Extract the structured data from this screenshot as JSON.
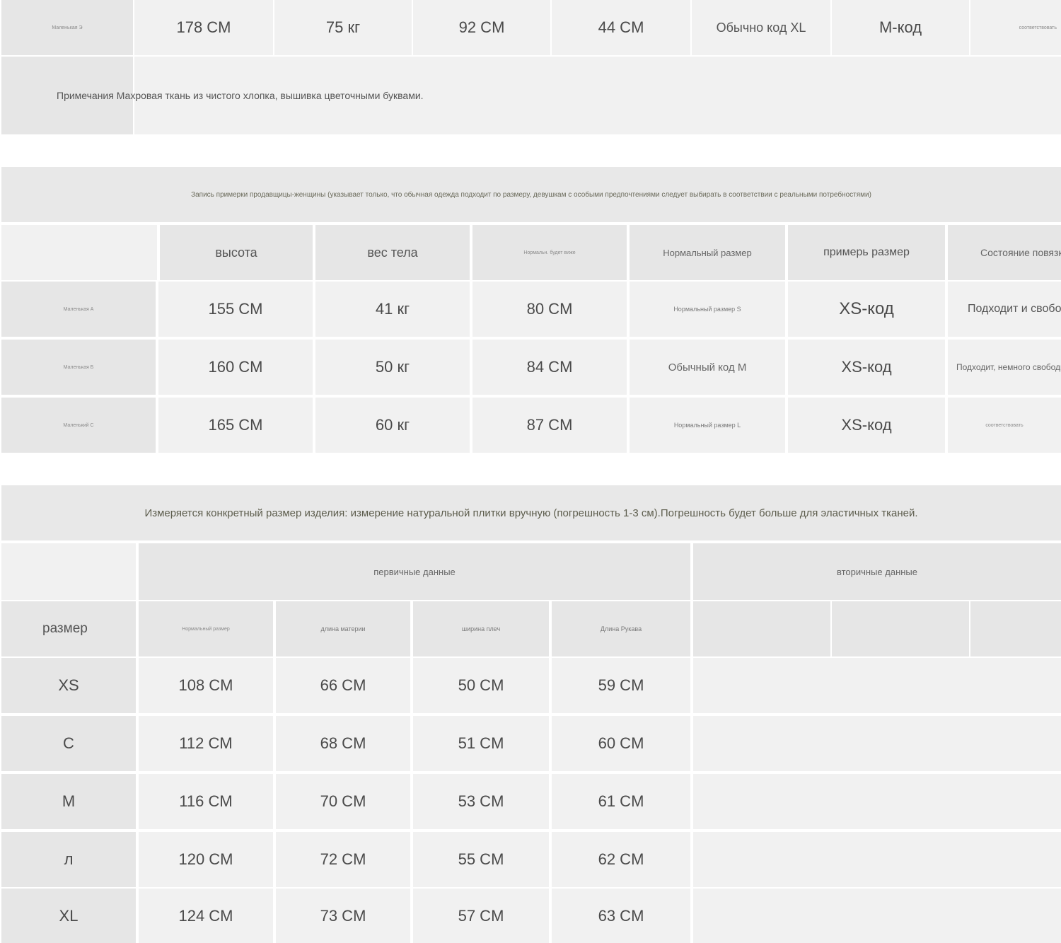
{
  "section1": {
    "row": {
      "name": "Маленькая Э",
      "height": "178 CM",
      "weight": "75 кг",
      "bust": "92 CM",
      "shoulder": "44 CM",
      "normal_size": "Обычно код XL",
      "tried_size": "M-код",
      "state": "соответствовать"
    },
    "note": "Примечания Махровая ткань из чистого хлопка, вышивка цветочными буквами."
  },
  "section2": {
    "notice": "Запись примерки продавщицы-женщины (указывает только, что обычная одежда подходит по размеру, девушкам с особыми предпочтениями следует выбирать в соответствии с реальными потребностями)",
    "headers": [
      "высота",
      "вес тела",
      "Нормальн. будет виже",
      "Нормальный размер",
      "примерь размер",
      "Состояние повязки"
    ],
    "rows": [
      {
        "name": "Маленькая А",
        "height": "155 CM",
        "weight": "41 кг",
        "bust": "80 CM",
        "normal_size": "Нормальный размер S",
        "tried_size": "XS-код",
        "state": "Подходит и свободно"
      },
      {
        "name": "Маленькая Б",
        "height": "160 CM",
        "weight": "50 кг",
        "bust": "84 CM",
        "normal_size": "Обычный код M",
        "tried_size": "XS-код",
        "state": "Подходит, немного свободно"
      },
      {
        "name": "Маленький С",
        "height": "165 CM",
        "weight": "60 кг",
        "bust": "87 CM",
        "normal_size": "Нормальный размер L",
        "tried_size": "XS-код",
        "state": "соответствовать"
      }
    ]
  },
  "section3": {
    "notice": "Измеряется конкретный размер изделия: измерение натуральной плитки вручную (погрешность 1-3 см).Погрешность будет больше для эластичных тканей.",
    "group_primary": "первичные данные",
    "group_secondary": "вторичные данные",
    "size_header": "размер",
    "col_headers": [
      "Нормальный размер",
      "длина материи",
      "ширина плеч",
      "Длина Рукава"
    ],
    "rows": [
      {
        "size": "XS",
        "v1": "108 CM",
        "v2": "66 CM",
        "v3": "50 CM",
        "v4": "59 CM"
      },
      {
        "size": "С",
        "v1": "112 CM",
        "v2": "68 CM",
        "v3": "51 CM",
        "v4": "60 CM"
      },
      {
        "size": "M",
        "v1": "116 CM",
        "v2": "70 CM",
        "v3": "53 CM",
        "v4": "61 CM"
      },
      {
        "size": "л",
        "v1": "120 CM",
        "v2": "72 CM",
        "v3": "55 CM",
        "v4": "62 CM"
      },
      {
        "size": "XL",
        "v1": "124 CM",
        "v2": "73 CM",
        "v3": "57 CM",
        "v4": "63 CM"
      }
    ]
  }
}
